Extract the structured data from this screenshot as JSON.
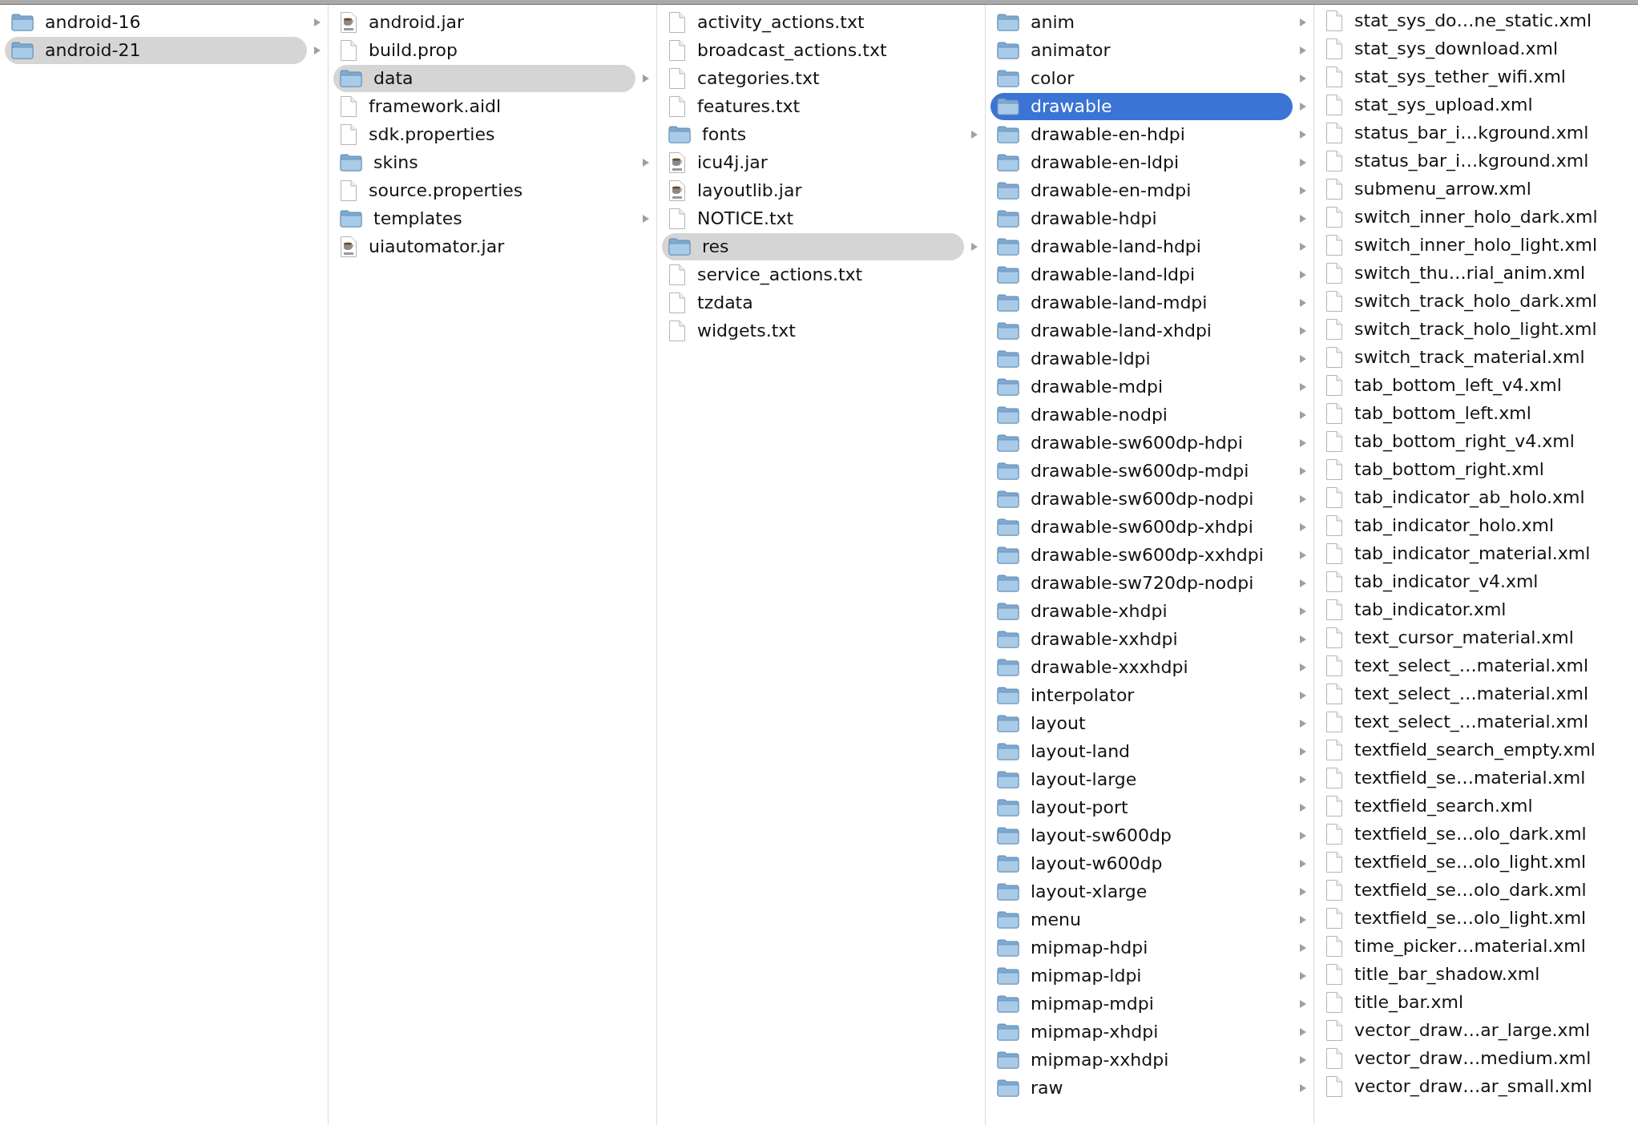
{
  "columns": [
    {
      "items": [
        {
          "name": "android-16",
          "kind": "folder",
          "selected": false
        },
        {
          "name": "android-21",
          "kind": "folder",
          "selected": true
        }
      ]
    },
    {
      "items": [
        {
          "name": "android.jar",
          "kind": "jar",
          "selected": false
        },
        {
          "name": "build.prop",
          "kind": "file",
          "selected": false
        },
        {
          "name": "data",
          "kind": "folder",
          "selected": true
        },
        {
          "name": "framework.aidl",
          "kind": "file",
          "selected": false
        },
        {
          "name": "sdk.properties",
          "kind": "file",
          "selected": false
        },
        {
          "name": "skins",
          "kind": "folder",
          "selected": false
        },
        {
          "name": "source.properties",
          "kind": "file",
          "selected": false
        },
        {
          "name": "templates",
          "kind": "folder",
          "selected": false
        },
        {
          "name": "uiautomator.jar",
          "kind": "jar",
          "selected": false
        }
      ]
    },
    {
      "items": [
        {
          "name": "activity_actions.txt",
          "kind": "file",
          "selected": false
        },
        {
          "name": "broadcast_actions.txt",
          "kind": "file",
          "selected": false
        },
        {
          "name": "categories.txt",
          "kind": "file",
          "selected": false
        },
        {
          "name": "features.txt",
          "kind": "file",
          "selected": false
        },
        {
          "name": "fonts",
          "kind": "folder",
          "selected": false
        },
        {
          "name": "icu4j.jar",
          "kind": "jar",
          "selected": false
        },
        {
          "name": "layoutlib.jar",
          "kind": "jar",
          "selected": false
        },
        {
          "name": "NOTICE.txt",
          "kind": "file",
          "selected": false
        },
        {
          "name": "res",
          "kind": "folder",
          "selected": true
        },
        {
          "name": "service_actions.txt",
          "kind": "file",
          "selected": false
        },
        {
          "name": "tzdata",
          "kind": "file",
          "selected": false
        },
        {
          "name": "widgets.txt",
          "kind": "file",
          "selected": false
        }
      ]
    },
    {
      "active": true,
      "items": [
        {
          "name": "anim",
          "kind": "folder",
          "selected": false
        },
        {
          "name": "animator",
          "kind": "folder",
          "selected": false
        },
        {
          "name": "color",
          "kind": "folder",
          "selected": false
        },
        {
          "name": "drawable",
          "kind": "folder",
          "selected": true
        },
        {
          "name": "drawable-en-hdpi",
          "kind": "folder",
          "selected": false
        },
        {
          "name": "drawable-en-ldpi",
          "kind": "folder",
          "selected": false
        },
        {
          "name": "drawable-en-mdpi",
          "kind": "folder",
          "selected": false
        },
        {
          "name": "drawable-hdpi",
          "kind": "folder",
          "selected": false
        },
        {
          "name": "drawable-land-hdpi",
          "kind": "folder",
          "selected": false
        },
        {
          "name": "drawable-land-ldpi",
          "kind": "folder",
          "selected": false
        },
        {
          "name": "drawable-land-mdpi",
          "kind": "folder",
          "selected": false
        },
        {
          "name": "drawable-land-xhdpi",
          "kind": "folder",
          "selected": false
        },
        {
          "name": "drawable-ldpi",
          "kind": "folder",
          "selected": false
        },
        {
          "name": "drawable-mdpi",
          "kind": "folder",
          "selected": false
        },
        {
          "name": "drawable-nodpi",
          "kind": "folder",
          "selected": false
        },
        {
          "name": "drawable-sw600dp-hdpi",
          "kind": "folder",
          "selected": false
        },
        {
          "name": "drawable-sw600dp-mdpi",
          "kind": "folder",
          "selected": false
        },
        {
          "name": "drawable-sw600dp-nodpi",
          "kind": "folder",
          "selected": false
        },
        {
          "name": "drawable-sw600dp-xhdpi",
          "kind": "folder",
          "selected": false
        },
        {
          "name": "drawable-sw600dp-xxhdpi",
          "kind": "folder",
          "selected": false
        },
        {
          "name": "drawable-sw720dp-nodpi",
          "kind": "folder",
          "selected": false
        },
        {
          "name": "drawable-xhdpi",
          "kind": "folder",
          "selected": false
        },
        {
          "name": "drawable-xxhdpi",
          "kind": "folder",
          "selected": false
        },
        {
          "name": "drawable-xxxhdpi",
          "kind": "folder",
          "selected": false
        },
        {
          "name": "interpolator",
          "kind": "folder",
          "selected": false
        },
        {
          "name": "layout",
          "kind": "folder",
          "selected": false
        },
        {
          "name": "layout-land",
          "kind": "folder",
          "selected": false
        },
        {
          "name": "layout-large",
          "kind": "folder",
          "selected": false
        },
        {
          "name": "layout-port",
          "kind": "folder",
          "selected": false
        },
        {
          "name": "layout-sw600dp",
          "kind": "folder",
          "selected": false
        },
        {
          "name": "layout-w600dp",
          "kind": "folder",
          "selected": false
        },
        {
          "name": "layout-xlarge",
          "kind": "folder",
          "selected": false
        },
        {
          "name": "menu",
          "kind": "folder",
          "selected": false
        },
        {
          "name": "mipmap-hdpi",
          "kind": "folder",
          "selected": false
        },
        {
          "name": "mipmap-ldpi",
          "kind": "folder",
          "selected": false
        },
        {
          "name": "mipmap-mdpi",
          "kind": "folder",
          "selected": false
        },
        {
          "name": "mipmap-xhdpi",
          "kind": "folder",
          "selected": false
        },
        {
          "name": "mipmap-xxhdpi",
          "kind": "folder",
          "selected": false
        },
        {
          "name": "raw",
          "kind": "folder",
          "selected": false
        }
      ]
    },
    {
      "items": [
        {
          "name": "stat_sys_do…ne_static.xml",
          "kind": "file",
          "selected": false
        },
        {
          "name": "stat_sys_download.xml",
          "kind": "file",
          "selected": false
        },
        {
          "name": "stat_sys_tether_wifi.xml",
          "kind": "file",
          "selected": false
        },
        {
          "name": "stat_sys_upload.xml",
          "kind": "file",
          "selected": false
        },
        {
          "name": "status_bar_i…kground.xml",
          "kind": "file",
          "selected": false
        },
        {
          "name": "status_bar_i…kground.xml",
          "kind": "file",
          "selected": false
        },
        {
          "name": "submenu_arrow.xml",
          "kind": "file",
          "selected": false
        },
        {
          "name": "switch_inner_holo_dark.xml",
          "kind": "file",
          "selected": false
        },
        {
          "name": "switch_inner_holo_light.xml",
          "kind": "file",
          "selected": false
        },
        {
          "name": "switch_thu…rial_anim.xml",
          "kind": "file",
          "selected": false
        },
        {
          "name": "switch_track_holo_dark.xml",
          "kind": "file",
          "selected": false
        },
        {
          "name": "switch_track_holo_light.xml",
          "kind": "file",
          "selected": false
        },
        {
          "name": "switch_track_material.xml",
          "kind": "file",
          "selected": false
        },
        {
          "name": "tab_bottom_left_v4.xml",
          "kind": "file",
          "selected": false
        },
        {
          "name": "tab_bottom_left.xml",
          "kind": "file",
          "selected": false
        },
        {
          "name": "tab_bottom_right_v4.xml",
          "kind": "file",
          "selected": false
        },
        {
          "name": "tab_bottom_right.xml",
          "kind": "file",
          "selected": false
        },
        {
          "name": "tab_indicator_ab_holo.xml",
          "kind": "file",
          "selected": false
        },
        {
          "name": "tab_indicator_holo.xml",
          "kind": "file",
          "selected": false
        },
        {
          "name": "tab_indicator_material.xml",
          "kind": "file",
          "selected": false
        },
        {
          "name": "tab_indicator_v4.xml",
          "kind": "file",
          "selected": false
        },
        {
          "name": "tab_indicator.xml",
          "kind": "file",
          "selected": false
        },
        {
          "name": "text_cursor_material.xml",
          "kind": "file",
          "selected": false
        },
        {
          "name": "text_select_…material.xml",
          "kind": "file",
          "selected": false
        },
        {
          "name": "text_select_…material.xml",
          "kind": "file",
          "selected": false
        },
        {
          "name": "text_select_…material.xml",
          "kind": "file",
          "selected": false
        },
        {
          "name": "textfield_search_empty.xml",
          "kind": "file",
          "selected": false
        },
        {
          "name": "textfield_se…material.xml",
          "kind": "file",
          "selected": false
        },
        {
          "name": "textfield_search.xml",
          "kind": "file",
          "selected": false
        },
        {
          "name": "textfield_se…olo_dark.xml",
          "kind": "file",
          "selected": false
        },
        {
          "name": "textfield_se…olo_light.xml",
          "kind": "file",
          "selected": false
        },
        {
          "name": "textfield_se…olo_dark.xml",
          "kind": "file",
          "selected": false
        },
        {
          "name": "textfield_se…olo_light.xml",
          "kind": "file",
          "selected": false
        },
        {
          "name": "time_picker…material.xml",
          "kind": "file",
          "selected": false
        },
        {
          "name": "title_bar_shadow.xml",
          "kind": "file",
          "selected": false
        },
        {
          "name": "title_bar.xml",
          "kind": "file",
          "selected": false
        },
        {
          "name": "vector_draw…ar_large.xml",
          "kind": "file",
          "selected": false
        },
        {
          "name": "vector_draw…medium.xml",
          "kind": "file",
          "selected": false
        },
        {
          "name": "vector_draw…ar_small.xml",
          "kind": "file",
          "selected": false
        }
      ]
    }
  ]
}
